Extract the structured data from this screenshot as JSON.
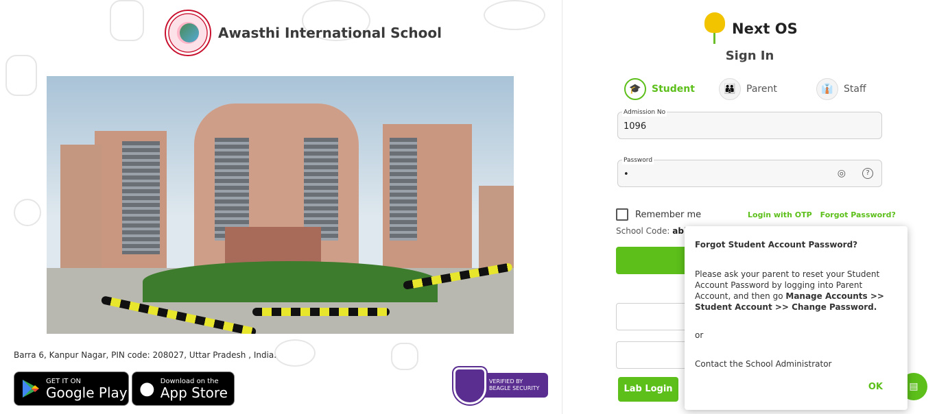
{
  "school": {
    "name": "Awasthi International School",
    "address": "Barra 6, Kanpur Nagar, PIN code: 208027, Uttar Pradesh , India."
  },
  "stores": {
    "google_top": "GET IT ON",
    "google_bottom": "Google Play",
    "apple_top": "Download on the",
    "apple_bottom": "App Store"
  },
  "security_badge": {
    "line1": "VERIFIED BY",
    "line2": "BEAGLE SECURITY"
  },
  "brand": {
    "name": "Next OS",
    "heading": "Sign In"
  },
  "roles": [
    {
      "label": "Student",
      "icon": "student-icon",
      "active": true
    },
    {
      "label": "Parent",
      "icon": "parent-icon",
      "active": false
    },
    {
      "label": "Staff",
      "icon": "staff-icon",
      "active": false
    }
  ],
  "form": {
    "admission_label": "Admission No",
    "admission_value": "1096",
    "password_label": "Password",
    "password_value": "•",
    "remember_label": "Remember me",
    "otp_link": "Login with OTP",
    "forgot_link": "Forgot Password?",
    "school_code_label": "School Code:",
    "school_code_value": "abh",
    "lab_login": "Lab Login"
  },
  "popup": {
    "title": "Forgot Student Account Password?",
    "message_text": "Please ask your parent to reset your Student Account Password by logging into Parent Account, and then go",
    "message_bold": "Manage Accounts >> Student Account >> Change Password.",
    "or": "or",
    "contact": "Contact the School Administrator",
    "ok": "OK"
  },
  "colors": {
    "accent": "#5cbf1a",
    "badge": "#5a2d91"
  }
}
